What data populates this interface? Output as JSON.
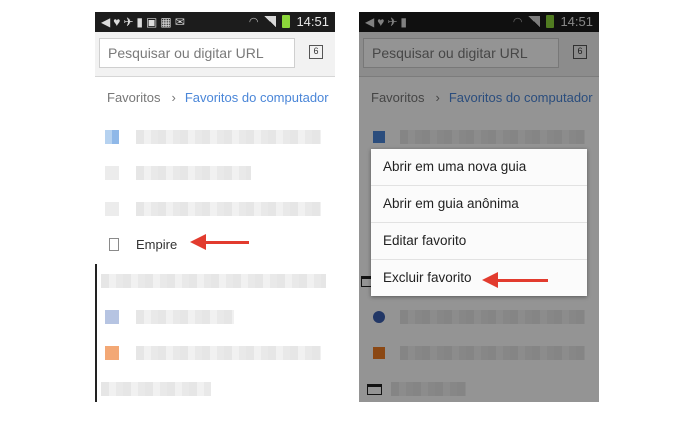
{
  "status_bar": {
    "time": "14:51",
    "notification_icons": [
      "back-icon",
      "twitter-icon",
      "messenger-icon",
      "android-icon",
      "calendar-icon",
      "image-icon",
      "gmail-icon"
    ],
    "system_icons": [
      "wifi-icon",
      "signal-icon",
      "battery-icon"
    ]
  },
  "toolbar": {
    "search_placeholder": "Pesquisar ou digitar URL",
    "tab_count": "6"
  },
  "breadcrumb": {
    "root": "Favoritos",
    "separator": "›",
    "current": "Favoritos do computador"
  },
  "bookmarks": {
    "visible_item": "Empire"
  },
  "context_menu": {
    "items": [
      "Abrir em uma nova guia",
      "Abrir em guia anônima",
      "Editar favorito",
      "Excluir favorito"
    ]
  },
  "colors": {
    "accent_blue": "#4a86d8",
    "arrow_red": "#e23b2e",
    "battery_green": "#8cd63a"
  }
}
